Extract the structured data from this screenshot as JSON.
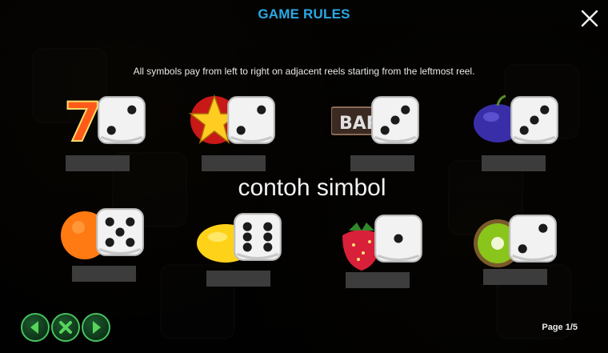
{
  "header": {
    "title": "GAME RULES",
    "close_icon": "close-icon"
  },
  "intro": "All symbols pay from left to right on adjacent reels starting from the leftmost reel.",
  "caption": "contoh simbol",
  "symbols": [
    {
      "name": "seven",
      "icon": "seven-icon",
      "dice": 2
    },
    {
      "name": "star",
      "icon": "star-icon",
      "dice": 2
    },
    {
      "name": "bar",
      "icon": "bar-icon",
      "label": "BAR",
      "dice": 3
    },
    {
      "name": "plum",
      "icon": "plum-icon",
      "dice": 3
    },
    {
      "name": "orange",
      "icon": "orange-icon",
      "dice": 5
    },
    {
      "name": "lemon",
      "icon": "lemon-icon",
      "dice": 6
    },
    {
      "name": "strawberry",
      "icon": "strawberry-icon",
      "dice": 1
    },
    {
      "name": "kiwi",
      "icon": "kiwi-icon",
      "dice": 2
    }
  ],
  "footer": {
    "page": "Page 1/5",
    "nav": [
      "prev-arrow-icon",
      "close-x-icon",
      "next-arrow-icon"
    ]
  },
  "colors": {
    "title": "#2aa9e6",
    "nav_green": "#47c25e"
  }
}
